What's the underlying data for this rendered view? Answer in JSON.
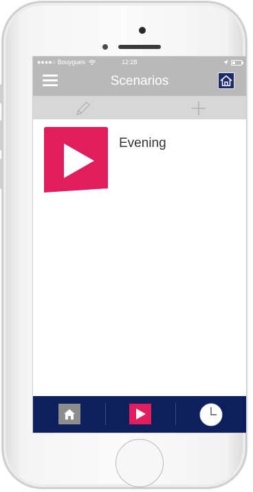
{
  "status_bar": {
    "carrier": "●●●●○ Bouygues",
    "time": "12:28",
    "battery_level": 0.3
  },
  "nav": {
    "title": "Scenarios",
    "menu_icon": "hamburger-menu-icon",
    "home_icon": "house-icon"
  },
  "toolbar": {
    "edit_icon": "pencil-icon",
    "add_icon": "plus-icon"
  },
  "scenarios": [
    {
      "name": "Evening",
      "icon": "play-icon"
    }
  ],
  "tab_bar": {
    "tabs": [
      {
        "icon": "home-icon",
        "active": false
      },
      {
        "icon": "play-icon",
        "active": true
      },
      {
        "icon": "clock-icon",
        "active": false
      }
    ]
  },
  "colors": {
    "accent": "#e01d5d",
    "nav_gray": "#b9b9b9",
    "toolbar_gray": "#d7d7d7",
    "tab_bar_navy": "#0d1f5c"
  }
}
